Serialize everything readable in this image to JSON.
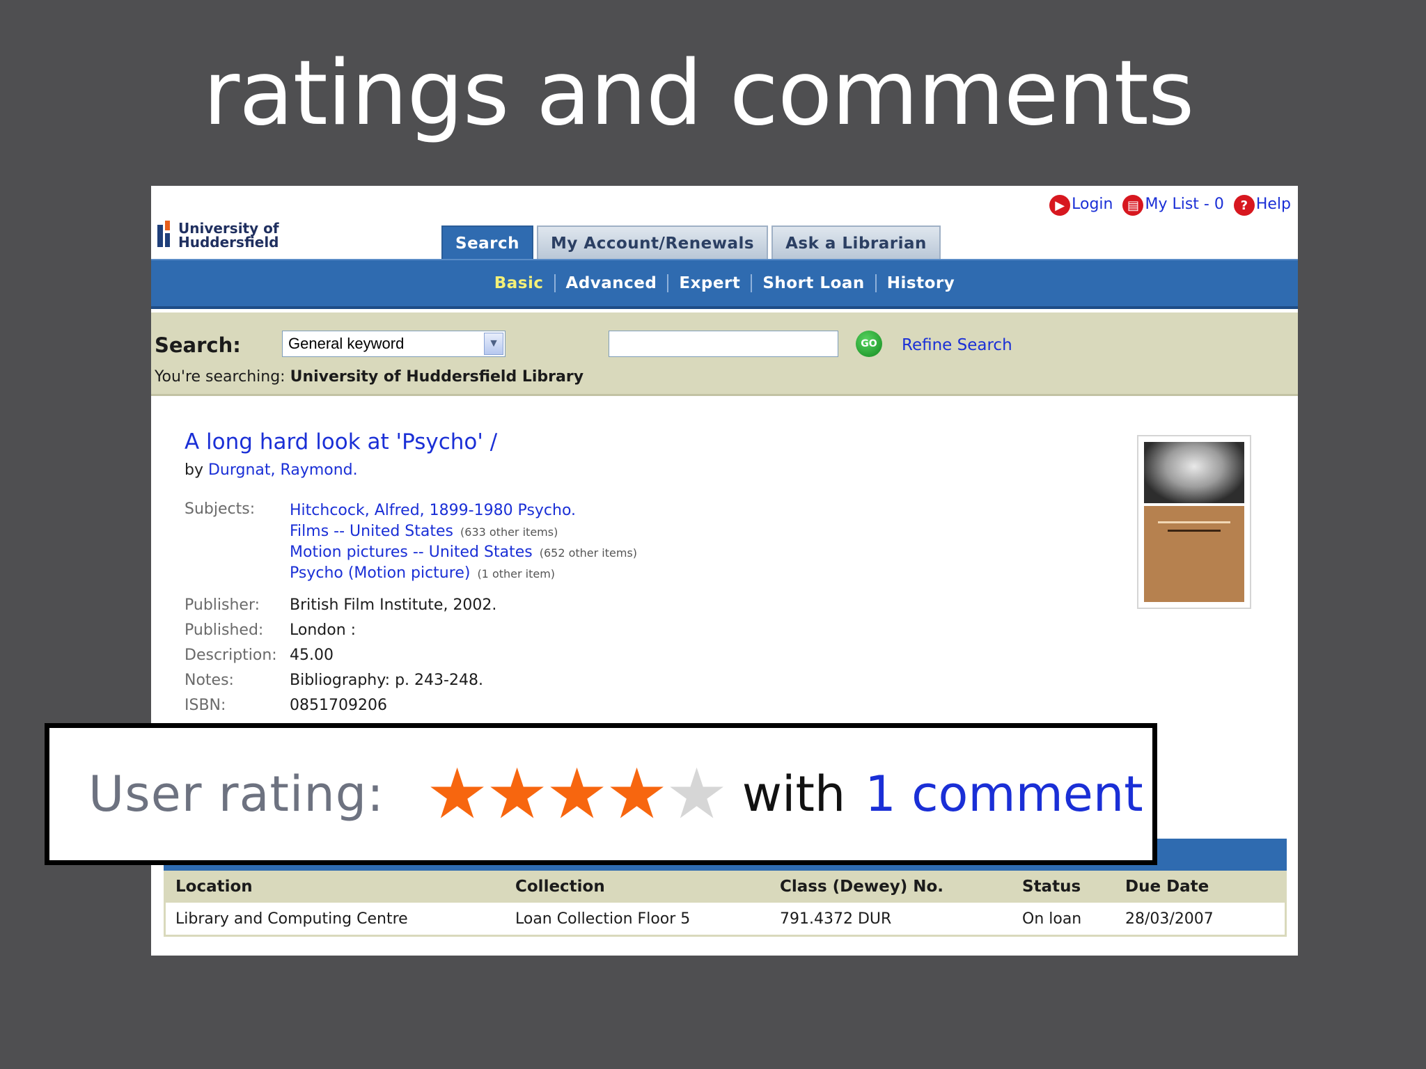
{
  "slide": {
    "title": "ratings and comments"
  },
  "header": {
    "logo_line1": "University of",
    "logo_line2": "Huddersfield",
    "links": {
      "login": "Login",
      "my_list": "My List - 0",
      "help": "Help"
    },
    "tabs": [
      "Search",
      "My Account/Renewals",
      "Ask a Librarian"
    ],
    "subnav": [
      "Basic",
      "Advanced",
      "Expert",
      "Short Loan",
      "History"
    ]
  },
  "search": {
    "label": "Search:",
    "select_value": "General keyword",
    "go_label": "GO",
    "refine_label": "Refine Search",
    "searching_prefix": "You're searching:",
    "searching_target": "University of Huddersfield Library"
  },
  "record": {
    "title": "A long hard look at 'Psycho' /",
    "by": "by",
    "author": "Durgnat, Raymond.",
    "subjects_label": "Subjects:",
    "subjects": [
      {
        "text": "Hitchcock, Alfred, 1899-1980 Psycho.",
        "count": ""
      },
      {
        "text": "Films -- United States",
        "count": "(633 other items)"
      },
      {
        "text": "Motion pictures -- United States",
        "count": "(652 other items)"
      },
      {
        "text": "Psycho (Motion picture)",
        "count": "(1 other item)"
      }
    ],
    "fields": [
      {
        "label": "Publisher:",
        "value": "British Film Institute, 2002."
      },
      {
        "label": "Published:",
        "value": "London :"
      },
      {
        "label": "Description:",
        "value": "45.00"
      },
      {
        "label": "Notes:",
        "value": "Bibliography: p. 243-248."
      },
      {
        "label": "ISBN:",
        "value": "0851709206"
      }
    ]
  },
  "rating": {
    "label": "User rating:",
    "stars_filled": 4,
    "stars_total": 5,
    "with_text": "with",
    "comment_text": "1 comment"
  },
  "holdings": {
    "headers": [
      "Location",
      "Collection",
      "Class (Dewey) No.",
      "Status",
      "Due Date"
    ],
    "rows": [
      [
        "Library and Computing Centre",
        "Loan Collection Floor 5",
        "791.4372 DUR",
        "On loan",
        "28/03/2007"
      ]
    ]
  }
}
